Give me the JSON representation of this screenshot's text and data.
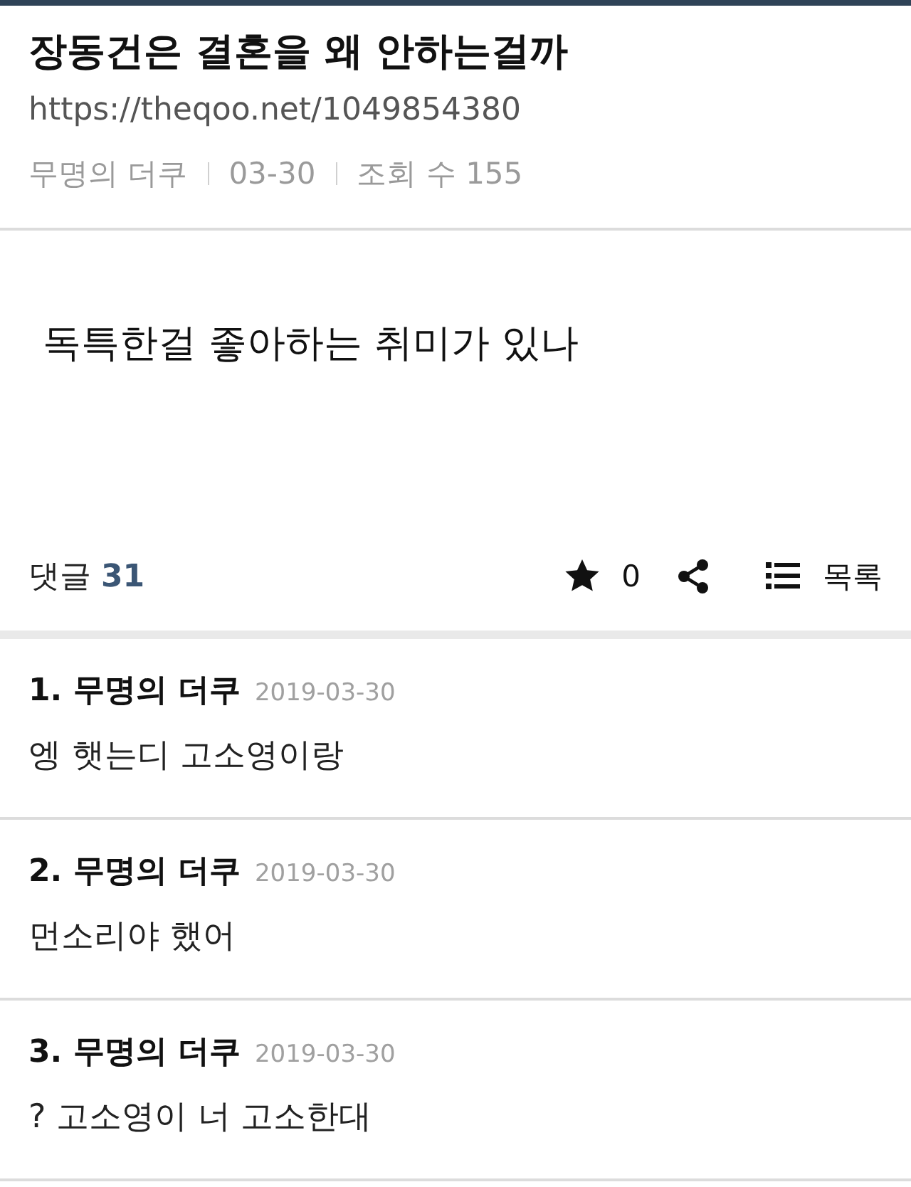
{
  "post": {
    "title": "장동건은 결혼을 왜 안하는걸까",
    "url": "https://theqoo.net/1049854380",
    "meta": [
      "무명의 더쿠",
      "03-30",
      "조회 수 155"
    ],
    "body": "독특한걸 좋아하는 취미가 있나"
  },
  "toolbar": {
    "comments_label": "댓글",
    "comments_count": "31",
    "star_count": "0",
    "list_label": "목록"
  },
  "comments": [
    {
      "heading": "1. 무명의 더쿠",
      "date": "2019-03-30",
      "text": "엥 햇는디 고소영이랑"
    },
    {
      "heading": "2. 무명의 더쿠",
      "date": "2019-03-30",
      "text": "먼소리야 했어"
    },
    {
      "heading": "3. 무명의 더쿠",
      "date": "2019-03-30",
      "text": "? 고소영이 너 고소한대"
    }
  ]
}
